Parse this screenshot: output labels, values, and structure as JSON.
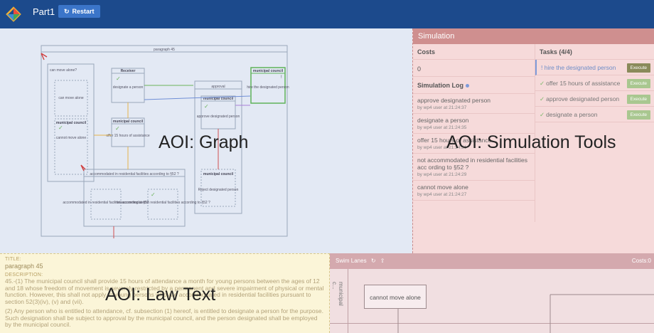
{
  "header": {
    "app_title": "Part1",
    "restart_label": "Restart",
    "restart_icon": "refresh-icon",
    "logo_icon": "diamond-logo-icon",
    "colors": {
      "bar": "#1c4a8c",
      "button": "#3b75c9"
    }
  },
  "graph": {
    "container_title": "paragraph 45",
    "nodes": {
      "can_move_alone_group": "can move alone?",
      "can_move_alone": "can move alone",
      "mc1_title": "municipal council",
      "mc1_text": "cannot move alone",
      "receiver_title": "Receiver",
      "receiver_text": "designate a person",
      "mc2_title": "municipal council",
      "mc2_text": "offer 15 hours of assistance",
      "approval_group": "approval",
      "mc3_title": "municipal council",
      "mc3_text": "approve designated person",
      "mc4_title": "municipal council",
      "mc4_text": "Reject designated person",
      "mc5_title": "municipal council",
      "mc5_text": "hire the designated person",
      "mc5_mark": "!",
      "accommodated_group": "accommodated in residential facilities according to §52 ?",
      "accommodated_text": "accommodated in residential facilities according to §52",
      "not_accommodated_text": "not accommodated in residential facilities according to §52 ?"
    }
  },
  "simulation": {
    "title": "Simulation",
    "costs_label": "Costs",
    "costs_value": "0",
    "log_title": "Simulation Log",
    "log": [
      {
        "text": "approve designated person",
        "meta": "by wp4 user at 21:24:37"
      },
      {
        "text": "designate a person",
        "meta": "by wp4 user at 21:24:35"
      },
      {
        "text": "offer 15 hours of assistance",
        "meta": "by wp4 user at 21:24:31"
      },
      {
        "text": "not accommodated in residential facilities acc ording to §52 ?",
        "meta": "by wp4 user at 21:24:29"
      },
      {
        "text": "cannot move alone",
        "meta": "by wp4 user at 21:24:27"
      }
    ],
    "tasks_title": "Tasks (4/4)",
    "tasks": [
      {
        "label": "! hire the designated person",
        "button": "Execute"
      },
      {
        "label": "offer 15 hours of assistance",
        "button": "Execute"
      },
      {
        "label": "approve designated person",
        "button": "Execute"
      },
      {
        "label": "designate a person",
        "button": "Execute"
      }
    ]
  },
  "law": {
    "title_label": "TITLE:",
    "title": "paragraph 45",
    "description_label": "DESCRIPTION:",
    "paragraph1": "45.-(1) The municipal council shall provide 15 hours of attendance a month for young persons between the ages of 12 and 18 whose freedom of movement is severely restricted by a permanent and severe impairment of physical or mental function. However, this shall not apply to young persons who are accommodated in residential facilities pursuant to section 52(3)(iv), (v) and (vii).",
    "paragraph2": "(2) Any person who is entitled to attendance, cf. subsection (1) hereof, is entitled to designate a person for the purpose. Such designation shall be subject to approval by the municipal council, and the person designated shall be employed by the municipal council."
  },
  "swimlanes": {
    "title": "Swim Lanes",
    "refresh_icon": "refresh-icon",
    "upload_icon": "upload-icon",
    "costs": "Costs:0",
    "lane_label": "municipal c...",
    "box": "cannot move alone"
  },
  "aoi": {
    "graph": "AOI: Graph",
    "simulation": "AOI: Simulation Tools",
    "law": "AOI: Law Text"
  }
}
